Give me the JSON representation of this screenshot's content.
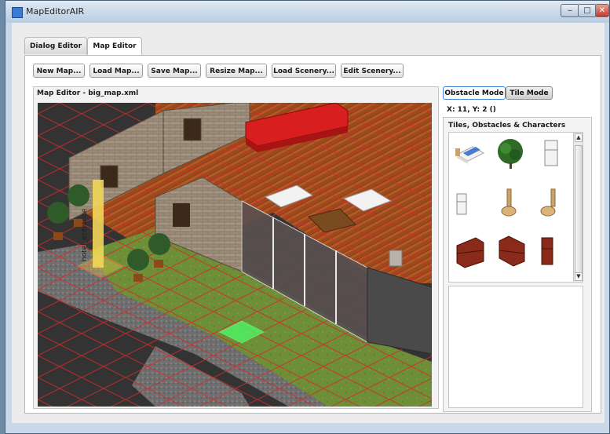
{
  "window": {
    "title": "MapEditorAIR",
    "controls": {
      "minimize": "‒",
      "maximize": "□",
      "close": "✕"
    }
  },
  "tabs": [
    {
      "label": "Dialog Editor",
      "active": false
    },
    {
      "label": "Map Editor",
      "active": true
    }
  ],
  "toolbar": {
    "new_map": "New Map...",
    "load_map": "Load Map...",
    "save_map": "Save Map...",
    "resize_map": "Resize Map...",
    "load_scenery": "Load Scenery...",
    "edit_scenery": "Edit Scenery..."
  },
  "map_editor": {
    "title": "Map Editor - big_map.xml",
    "entrance_label": "hotel_entrance"
  },
  "modes": {
    "obstacle": "Obstacle Mode",
    "tile": "Tile Mode",
    "active": "obstacle"
  },
  "coords": "X: 11, Y: 2 ()",
  "tiles_panel": {
    "title": "Tiles, Obstacles & Characters",
    "items": [
      "bed-icon",
      "tree-icon",
      "fridge-icon",
      "small-fridge-icon",
      "toilet-icon",
      "toilet-icon",
      "brick-wall-icon",
      "brick-wall-icon",
      "brick-pillar-icon"
    ]
  },
  "colors": {
    "accent": "#3b82d6",
    "grid_line": "#d42a2a",
    "highlight_tile": "#4cff6a",
    "entrance_tile": "#f2c94c"
  }
}
